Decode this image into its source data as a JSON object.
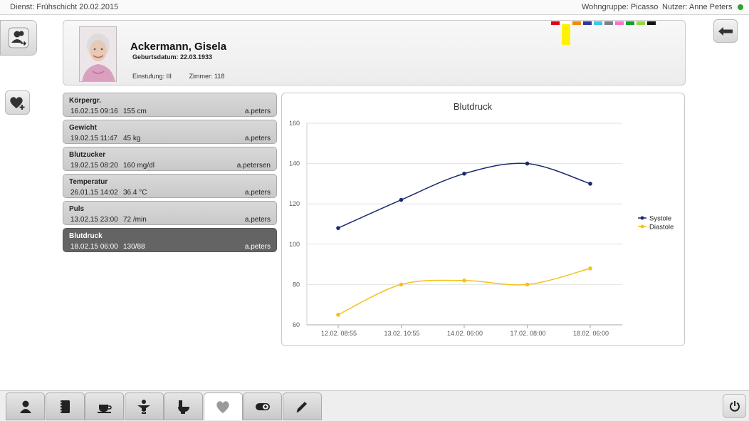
{
  "topbar": {
    "dienst": "Dienst: Frühschicht 20.02.2015",
    "wohngruppe": "Wohngruppe: Picasso",
    "nutzer": "Nutzer: Anne Peters",
    "status_color": "#2fa033"
  },
  "patient": {
    "name": "Ackermann, Gisela",
    "geburtsdatum": "Geburtsdatum: 22.03.1933",
    "einstufung": "Einstufung: III",
    "zimmer": "Zimmer: 118",
    "color_markers": [
      "#e3001b",
      "#ffffff",
      "#f28c00",
      "#2b3a9b",
      "#3ec7e8",
      "#7f7f7f",
      "#ff6fcf",
      "#15a02d",
      "#8fdc3b",
      "#111111"
    ],
    "highlight_color": "#fff200"
  },
  "vitals": [
    {
      "name": "Körpergr.",
      "date": "16.02.15 09:16",
      "value": "155 cm",
      "user": "a.peters",
      "active": false
    },
    {
      "name": "Gewicht",
      "date": "19.02.15 11:47",
      "value": "45 kg",
      "user": "a.peters",
      "active": false
    },
    {
      "name": "Blutzucker",
      "date": "19.02.15 08:20",
      "value": "160 mg/dl",
      "user": "a.petersen",
      "active": false
    },
    {
      "name": "Temperatur",
      "date": "26.01.15 14:02",
      "value": "36.4 °C",
      "user": "a.peters",
      "active": false
    },
    {
      "name": "Puls",
      "date": "13.02.15 23:00",
      "value": "72 /min",
      "user": "a.peters",
      "active": false
    },
    {
      "name": "Blutdruck",
      "date": "18.02.15 06:00",
      "value": "130/88",
      "user": "a.peters",
      "active": true
    }
  ],
  "chart_data": {
    "type": "line",
    "title": "Blutdruck",
    "categories": [
      "12.02. 08:55",
      "13.02. 10:55",
      "14.02. 06:00",
      "17.02. 08:00",
      "18.02. 06:00"
    ],
    "series": [
      {
        "name": "Systole",
        "color": "#1a2a6c",
        "values": [
          108,
          122,
          135,
          140,
          130
        ]
      },
      {
        "name": "Diastole",
        "color": "#f5c11a",
        "values": [
          65,
          80,
          82,
          80,
          88
        ]
      }
    ],
    "ylim": [
      60,
      160
    ],
    "yticks": [
      60,
      80,
      100,
      120,
      140,
      160
    ],
    "grid": true,
    "legend": "right"
  },
  "icons": {
    "left_top": "user-switch-icon",
    "left_heart": "heart-add-icon",
    "back": "arrow-left-icon",
    "power": "power-icon"
  },
  "tabs": [
    {
      "icon": "person-icon",
      "active": false
    },
    {
      "icon": "notebook-icon",
      "active": false
    },
    {
      "icon": "cup-icon",
      "active": false
    },
    {
      "icon": "care-figure-icon",
      "active": false
    },
    {
      "icon": "toilet-icon",
      "active": false
    },
    {
      "icon": "heart-icon",
      "active": true
    },
    {
      "icon": "pill-icon",
      "active": false
    },
    {
      "icon": "pencil-icon",
      "active": false
    }
  ]
}
